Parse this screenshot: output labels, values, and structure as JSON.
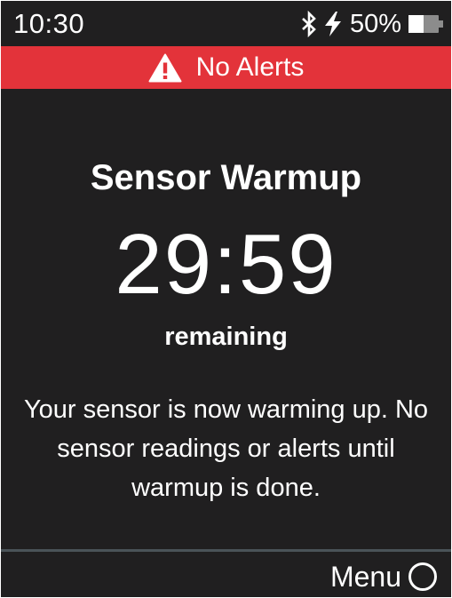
{
  "status_bar": {
    "time": "10:30",
    "bluetooth_icon": "bluetooth-icon",
    "charging_icon": "lightning-bolt-icon",
    "battery_percent": "50%",
    "battery_level": 0.5
  },
  "alert_banner": {
    "icon": "warning-triangle-icon",
    "text": "No Alerts",
    "color": "#e3333a"
  },
  "main": {
    "title": "Sensor Warmup",
    "countdown": "29:59",
    "countdown_caption": "remaining",
    "message": "Your sensor is now warming up. No sensor readings or alerts until warmup is done."
  },
  "footer": {
    "menu_label": "Menu",
    "menu_icon": "circle-button-icon"
  },
  "colors": {
    "background": "#201f20",
    "alert": "#e3333a",
    "divider": "#4a5358",
    "text": "#ffffff"
  }
}
